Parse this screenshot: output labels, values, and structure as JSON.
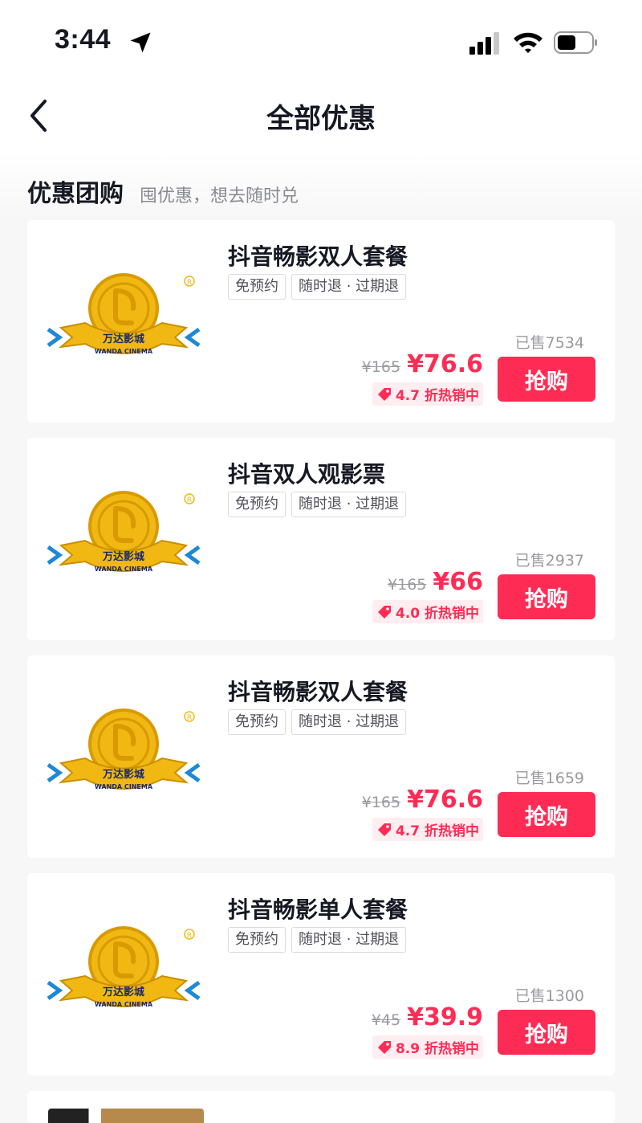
{
  "status_bar": {
    "time": "3:44"
  },
  "nav": {
    "title": "全部优惠"
  },
  "section": {
    "title": "优惠团购",
    "subtitle": "囤优惠，想去随时兑"
  },
  "deals": [
    {
      "title": "抖音畅影双人套餐",
      "tags": [
        "免预约",
        "随时退 · 过期退"
      ],
      "sold": "已售7534",
      "original_price": "¥165",
      "price": "¥76.6",
      "discount": "4.7 折热销中",
      "buy_label": "抢购"
    },
    {
      "title": "抖音双人观影票",
      "tags": [
        "免预约",
        "随时退 · 过期退"
      ],
      "sold": "已售2937",
      "original_price": "¥165",
      "price": "¥66",
      "discount": "4.0 折热销中",
      "buy_label": "抢购"
    },
    {
      "title": "抖音畅影双人套餐",
      "tags": [
        "免预约",
        "随时退 · 过期退"
      ],
      "sold": "已售1659",
      "original_price": "¥165",
      "price": "¥76.6",
      "discount": "4.7 折热销中",
      "buy_label": "抢购"
    },
    {
      "title": "抖音畅影单人套餐",
      "tags": [
        "免预约",
        "随时退 · 过期退"
      ],
      "sold": "已售1300",
      "original_price": "¥45",
      "price": "¥39.9",
      "discount": "8.9 折热销中",
      "buy_label": "抢购"
    }
  ],
  "logo": {
    "brand_cn": "万达影城",
    "brand_en": "WANDA CINEMA"
  },
  "colors": {
    "accent": "#fe2c55",
    "logo_gold": "#f1b814",
    "logo_blue": "#1e88d6"
  },
  "icons": [
    "location-arrow-icon",
    "signal-icon",
    "wifi-icon",
    "battery-icon",
    "back-chevron-icon",
    "tag-icon"
  ]
}
